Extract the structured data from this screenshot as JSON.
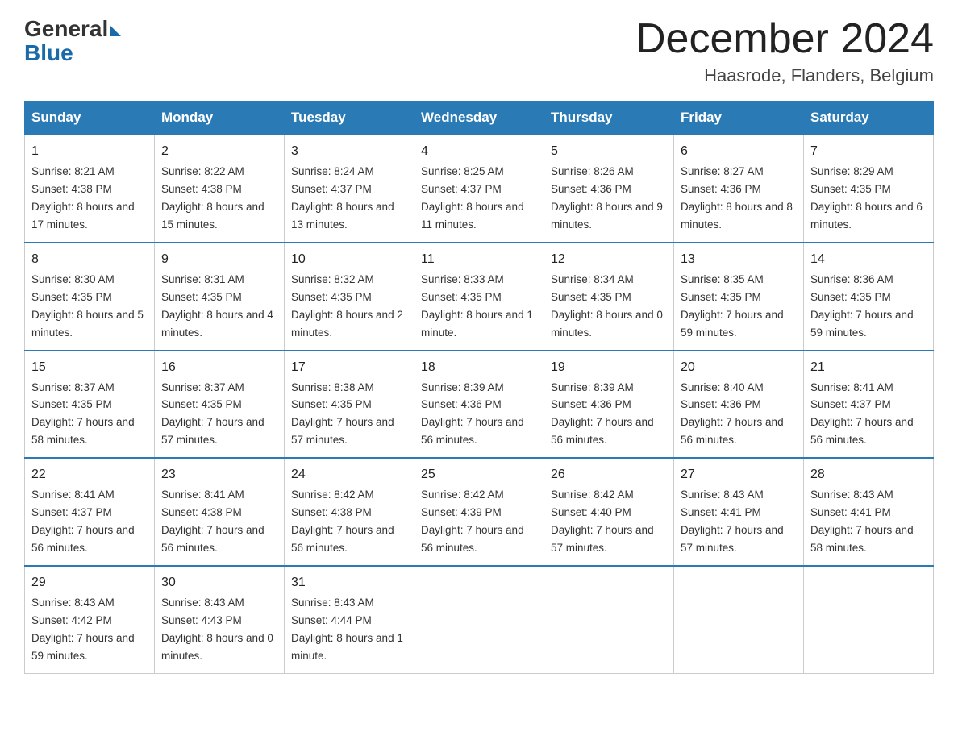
{
  "header": {
    "logo_general": "General",
    "logo_blue": "Blue",
    "month_title": "December 2024",
    "location": "Haasrode, Flanders, Belgium"
  },
  "weekdays": [
    "Sunday",
    "Monday",
    "Tuesday",
    "Wednesday",
    "Thursday",
    "Friday",
    "Saturday"
  ],
  "weeks": [
    [
      {
        "day": "1",
        "sunrise": "8:21 AM",
        "sunset": "4:38 PM",
        "daylight": "8 hours and 17 minutes."
      },
      {
        "day": "2",
        "sunrise": "8:22 AM",
        "sunset": "4:38 PM",
        "daylight": "8 hours and 15 minutes."
      },
      {
        "day": "3",
        "sunrise": "8:24 AM",
        "sunset": "4:37 PM",
        "daylight": "8 hours and 13 minutes."
      },
      {
        "day": "4",
        "sunrise": "8:25 AM",
        "sunset": "4:37 PM",
        "daylight": "8 hours and 11 minutes."
      },
      {
        "day": "5",
        "sunrise": "8:26 AM",
        "sunset": "4:36 PM",
        "daylight": "8 hours and 9 minutes."
      },
      {
        "day": "6",
        "sunrise": "8:27 AM",
        "sunset": "4:36 PM",
        "daylight": "8 hours and 8 minutes."
      },
      {
        "day": "7",
        "sunrise": "8:29 AM",
        "sunset": "4:35 PM",
        "daylight": "8 hours and 6 minutes."
      }
    ],
    [
      {
        "day": "8",
        "sunrise": "8:30 AM",
        "sunset": "4:35 PM",
        "daylight": "8 hours and 5 minutes."
      },
      {
        "day": "9",
        "sunrise": "8:31 AM",
        "sunset": "4:35 PM",
        "daylight": "8 hours and 4 minutes."
      },
      {
        "day": "10",
        "sunrise": "8:32 AM",
        "sunset": "4:35 PM",
        "daylight": "8 hours and 2 minutes."
      },
      {
        "day": "11",
        "sunrise": "8:33 AM",
        "sunset": "4:35 PM",
        "daylight": "8 hours and 1 minute."
      },
      {
        "day": "12",
        "sunrise": "8:34 AM",
        "sunset": "4:35 PM",
        "daylight": "8 hours and 0 minutes."
      },
      {
        "day": "13",
        "sunrise": "8:35 AM",
        "sunset": "4:35 PM",
        "daylight": "7 hours and 59 minutes."
      },
      {
        "day": "14",
        "sunrise": "8:36 AM",
        "sunset": "4:35 PM",
        "daylight": "7 hours and 59 minutes."
      }
    ],
    [
      {
        "day": "15",
        "sunrise": "8:37 AM",
        "sunset": "4:35 PM",
        "daylight": "7 hours and 58 minutes."
      },
      {
        "day": "16",
        "sunrise": "8:37 AM",
        "sunset": "4:35 PM",
        "daylight": "7 hours and 57 minutes."
      },
      {
        "day": "17",
        "sunrise": "8:38 AM",
        "sunset": "4:35 PM",
        "daylight": "7 hours and 57 minutes."
      },
      {
        "day": "18",
        "sunrise": "8:39 AM",
        "sunset": "4:36 PM",
        "daylight": "7 hours and 56 minutes."
      },
      {
        "day": "19",
        "sunrise": "8:39 AM",
        "sunset": "4:36 PM",
        "daylight": "7 hours and 56 minutes."
      },
      {
        "day": "20",
        "sunrise": "8:40 AM",
        "sunset": "4:36 PM",
        "daylight": "7 hours and 56 minutes."
      },
      {
        "day": "21",
        "sunrise": "8:41 AM",
        "sunset": "4:37 PM",
        "daylight": "7 hours and 56 minutes."
      }
    ],
    [
      {
        "day": "22",
        "sunrise": "8:41 AM",
        "sunset": "4:37 PM",
        "daylight": "7 hours and 56 minutes."
      },
      {
        "day": "23",
        "sunrise": "8:41 AM",
        "sunset": "4:38 PM",
        "daylight": "7 hours and 56 minutes."
      },
      {
        "day": "24",
        "sunrise": "8:42 AM",
        "sunset": "4:38 PM",
        "daylight": "7 hours and 56 minutes."
      },
      {
        "day": "25",
        "sunrise": "8:42 AM",
        "sunset": "4:39 PM",
        "daylight": "7 hours and 56 minutes."
      },
      {
        "day": "26",
        "sunrise": "8:42 AM",
        "sunset": "4:40 PM",
        "daylight": "7 hours and 57 minutes."
      },
      {
        "day": "27",
        "sunrise": "8:43 AM",
        "sunset": "4:41 PM",
        "daylight": "7 hours and 57 minutes."
      },
      {
        "day": "28",
        "sunrise": "8:43 AM",
        "sunset": "4:41 PM",
        "daylight": "7 hours and 58 minutes."
      }
    ],
    [
      {
        "day": "29",
        "sunrise": "8:43 AM",
        "sunset": "4:42 PM",
        "daylight": "7 hours and 59 minutes."
      },
      {
        "day": "30",
        "sunrise": "8:43 AM",
        "sunset": "4:43 PM",
        "daylight": "8 hours and 0 minutes."
      },
      {
        "day": "31",
        "sunrise": "8:43 AM",
        "sunset": "4:44 PM",
        "daylight": "8 hours and 1 minute."
      },
      null,
      null,
      null,
      null
    ]
  ],
  "labels": {
    "sunrise": "Sunrise:",
    "sunset": "Sunset:",
    "daylight": "Daylight:"
  }
}
